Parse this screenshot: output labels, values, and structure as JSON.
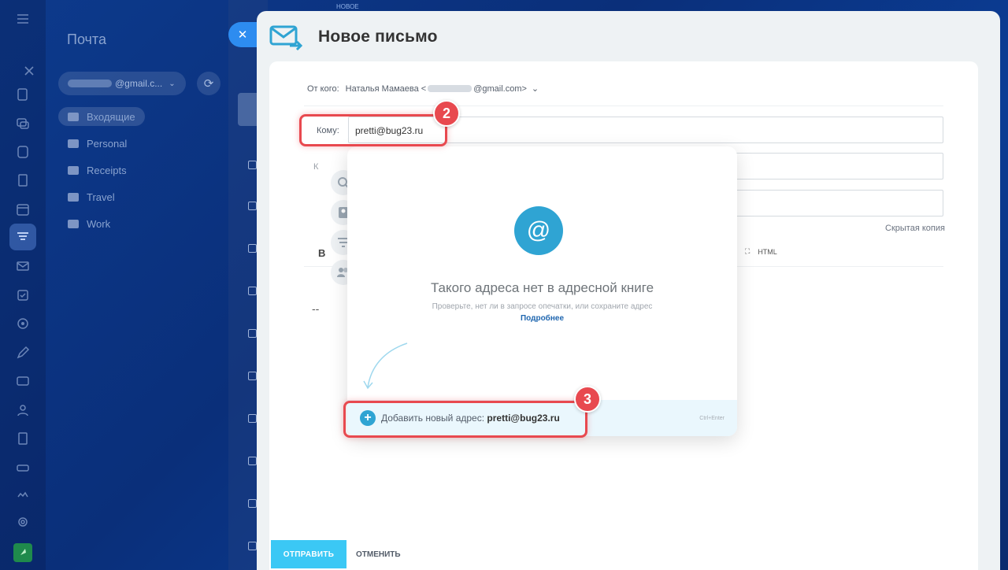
{
  "background_label": "НОВОЕ",
  "mail_sidebar": {
    "title": "Почта",
    "account": "@gmail.c...",
    "folders": [
      {
        "label": "Входящие"
      },
      {
        "label": "Personal"
      },
      {
        "label": "Receipts"
      },
      {
        "label": "Travel"
      },
      {
        "label": "Work"
      }
    ]
  },
  "compose": {
    "title": "Новое письмо",
    "from_label": "От кого:",
    "from_name": "Наталья Мамаева <",
    "from_domain": "@gmail.com>",
    "to_label": "Кому:",
    "to_value": "pretti@bug23.ru",
    "k_label": "К",
    "hidden_copy": "Скрытая копия",
    "html_label": "HTML",
    "bold_label": "B",
    "signature": "--",
    "send": "ОТПРАВИТЬ",
    "cancel": "ОТМЕНИТЬ"
  },
  "popup": {
    "title": "Такого адреса нет в адресной книге",
    "subtitle": "Проверьте, нет ли в запросе опечатки, или сохраните адрес",
    "link": "Подробнее",
    "add_prefix": "Добавить новый адрес: ",
    "add_email": "pretti@bug23.ru",
    "shortcut": "Ctrl+Enter"
  },
  "callouts": [
    {
      "number": "2"
    },
    {
      "number": "3"
    }
  ],
  "colors": {
    "accent": "#3bc8f5",
    "callout": "#e8494f",
    "popup_icon": "#2fa4d3"
  }
}
